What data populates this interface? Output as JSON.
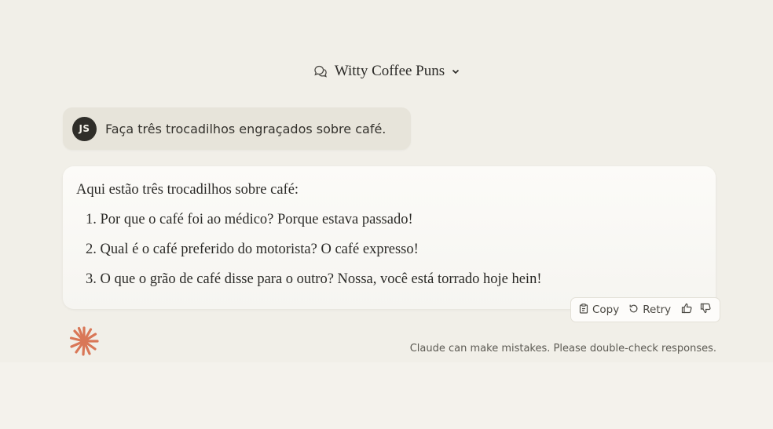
{
  "header": {
    "title": "Witty Coffee Puns",
    "chat_icon": "chat-bubbles-icon",
    "dropdown_icon": "chevron-down-icon"
  },
  "user_message": {
    "avatar_initials": "JS",
    "text": "Faça três trocadilhos engraçados sobre café."
  },
  "assistant_message": {
    "intro": "Aqui estão três trocadilhos sobre café:",
    "items": [
      {
        "number": "1.",
        "text": "Por que o café foi ao médico? Porque estava passado!"
      },
      {
        "number": "2.",
        "text": "Qual é o café preferido do motorista? O café expresso!"
      },
      {
        "number": "3.",
        "text": "O que o grão de café disse para o outro? Nossa, você está torrado hoje hein!"
      }
    ]
  },
  "actions": {
    "copy_label": "Copy",
    "retry_label": "Retry",
    "copy_icon": "clipboard-icon",
    "retry_icon": "retry-icon",
    "thumbs_up_icon": "thumbs-up-icon",
    "thumbs_down_icon": "thumbs-down-icon"
  },
  "footer": {
    "disclaimer": "Claude can make mistakes. Please double-check responses."
  },
  "colors": {
    "background": "#f0eee7",
    "user_bubble": "#e7e4da",
    "avatar": "#2f2e29",
    "logo_accent": "#d97757"
  }
}
